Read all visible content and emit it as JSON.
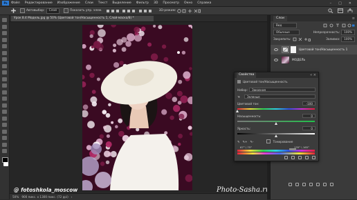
{
  "menubar": {
    "logo": "Ps",
    "items": [
      "Файл",
      "Редактирование",
      "Изображение",
      "Слои",
      "Текст",
      "Выделение",
      "Фильтр",
      "3D",
      "Просмотр",
      "Окно",
      "Справка"
    ],
    "window_controls": [
      "–",
      "□",
      "✕"
    ]
  },
  "optionsbar": {
    "autoselect_label": "Автовыбор:",
    "autoselect_value": "Слой",
    "transform_label": "Показать упр. элем.",
    "mode_3d": "3D-режим:"
  },
  "document": {
    "tab_title": "Урок 8.4   Модель.jpg @ 50% (Цветовой тон/Насыщенность 1, Слой-маска/8) *",
    "tab_close": "×"
  },
  "statusbar": {
    "zoom": "50%",
    "doc_info": "900 пикс. х 1300 пикс. (72 ppi)"
  },
  "watermarks": {
    "left": "@ fotoshkola_moscow",
    "right": "Photo-Sasha.ru"
  },
  "layers_panel": {
    "tab": "Слои",
    "filter_value": "Вид",
    "blend_mode": "Обычные",
    "opacity_label": "Непрозрачность:",
    "opacity_value": "100%",
    "lock_label": "Закрепить:",
    "fill_label": "Заливка:",
    "fill_value": "100%",
    "layers": [
      {
        "name": "Цветовой тон/Насыщенность 1",
        "visible": true,
        "thumb": "adjustment"
      },
      {
        "name": "МОДЕЛЬ",
        "visible": true,
        "thumb": "photo"
      }
    ]
  },
  "properties": {
    "title": "Свойства",
    "close": "«  ×",
    "adjustment_name": "Цветовой тон/Насыщенность",
    "preset_label": "Набор:",
    "preset_value": "Заказная",
    "channel_value": "Зеленые",
    "hue_label": "Цветовой тон:",
    "hue_value": "-100",
    "saturation_label": "Насыщенность:",
    "saturation_value": "0",
    "lightness_label": "Яркость:",
    "lightness_value": "0",
    "colorize_label": "Тонирование",
    "range_left": "67° \\ 75°",
    "range_right": "135° \\ 165°",
    "hue_slider_fraction": 0.0,
    "saturation_slider_fraction": 0.5,
    "lightness_slider_fraction": 0.5
  },
  "colors": {
    "photo_bg": "#3a0a22",
    "hat": "#f1ede2",
    "dress": "#f4f1ec",
    "accent": "#2b7bd6"
  }
}
